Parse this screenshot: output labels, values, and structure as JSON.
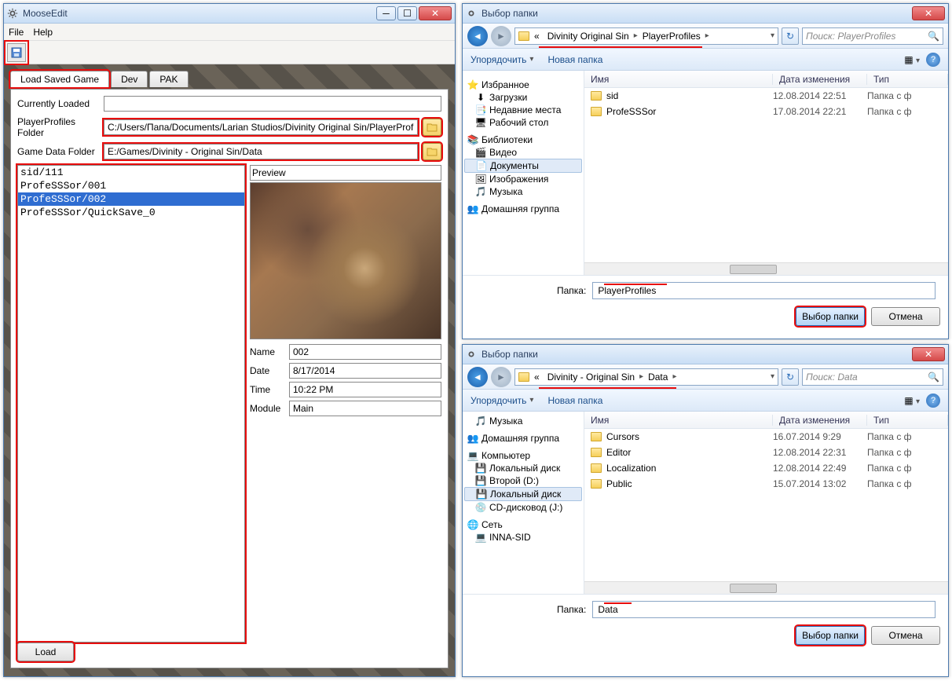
{
  "moose": {
    "title": "MooseEdit",
    "menu": {
      "file": "File",
      "help": "Help"
    },
    "tabs": {
      "load": "Load Saved Game",
      "dev": "Dev",
      "pak": "PAK"
    },
    "currentlyLoadedLabel": "Currently Loaded",
    "currentlyLoadedValue": "",
    "playerProfilesLabel": "PlayerProfiles Folder",
    "playerProfilesValue": "C:/Users/Папа/Documents/Larian Studios/Divinity Original Sin/PlayerProfiles",
    "gameDataLabel": "Game Data Folder",
    "gameDataValue": "E:/Games/Divinity - Original Sin/Data",
    "saves": [
      "sid/111",
      "ProfeSSSor/001",
      "ProfeSSSor/002",
      "ProfeSSSor/QuickSave_0"
    ],
    "savesSelectedIndex": 2,
    "previewLabel": "Preview",
    "details": {
      "nameLabel": "Name",
      "nameValue": "002",
      "dateLabel": "Date",
      "dateValue": "8/17/2014",
      "timeLabel": "Time",
      "timeValue": "10:22 PM",
      "moduleLabel": "Module",
      "moduleValue": "Main"
    },
    "loadBtn": "Load"
  },
  "dlg1": {
    "title": "Выбор папки",
    "searchPlaceholder": "Поиск: PlayerProfiles",
    "breadcrumb": [
      "«",
      "Divinity Original Sin",
      "PlayerProfiles"
    ],
    "organize": "Упорядочить",
    "newFolder": "Новая папка",
    "cols": {
      "name": "Имя",
      "date": "Дата изменения",
      "type": "Тип"
    },
    "tree": {
      "fav": "Избранное",
      "downloads": "Загрузки",
      "recent": "Недавние места",
      "desktop": "Рабочий стол",
      "libs": "Библиотеки",
      "video": "Видео",
      "docs": "Документы",
      "images": "Изображения",
      "music": "Музыка",
      "homegroup": "Домашняя группа"
    },
    "items": [
      {
        "name": "sid",
        "date": "12.08.2014 22:51",
        "type": "Папка с ф"
      },
      {
        "name": "ProfeSSSor",
        "date": "17.08.2014 22:21",
        "type": "Папка с ф"
      }
    ],
    "folderLabel": "Папка:",
    "folderValue": "PlayerProfiles",
    "selectBtn": "Выбор папки",
    "cancelBtn": "Отмена"
  },
  "dlg2": {
    "title": "Выбор папки",
    "searchPlaceholder": "Поиск: Data",
    "breadcrumb": [
      "«",
      "Divinity - Original Sin",
      "Data"
    ],
    "organize": "Упорядочить",
    "newFolder": "Новая папка",
    "cols": {
      "name": "Имя",
      "date": "Дата изменения",
      "type": "Тип"
    },
    "tree": {
      "music": "Музыка",
      "homegroup": "Домашняя группа",
      "computer": "Компьютер",
      "localdisk": "Локальный диск",
      "second": "Второй (D:)",
      "localdisk2": "Локальный диск",
      "cd": "CD-дисковод (J:)",
      "network": "Сеть",
      "inna": "INNA-SID"
    },
    "items": [
      {
        "name": "Cursors",
        "date": "16.07.2014 9:29",
        "type": "Папка с ф"
      },
      {
        "name": "Editor",
        "date": "12.08.2014 22:31",
        "type": "Папка с ф"
      },
      {
        "name": "Localization",
        "date": "12.08.2014 22:49",
        "type": "Папка с ф"
      },
      {
        "name": "Public",
        "date": "15.07.2014 13:02",
        "type": "Папка с ф"
      }
    ],
    "folderLabel": "Папка:",
    "folderValue": "Data",
    "selectBtn": "Выбор папки",
    "cancelBtn": "Отмена"
  }
}
